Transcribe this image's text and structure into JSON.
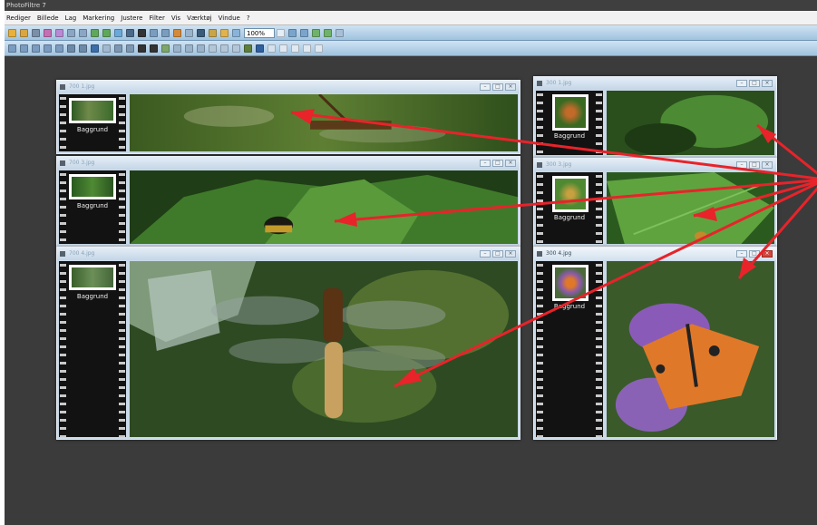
{
  "app": {
    "title": "PhotoFiltre 7",
    "menu": [
      "Rediger",
      "Billede",
      "Lag",
      "Markering",
      "Justere",
      "Filter",
      "Vis",
      "Værktøj",
      "Vindue",
      "?"
    ],
    "zoom_value": "100%"
  },
  "colors": {
    "workspace_bg": "#3b3b3b",
    "toolbar_top": "#cfe3f3",
    "window_frame": "#c9d9e8",
    "arrow": "#e8232a"
  },
  "windows": [
    {
      "title": "700 1.jpg",
      "layer_label": "Baggrund"
    },
    {
      "title": "300 1.jpg",
      "layer_label": "Baggrund"
    },
    {
      "title": "700 3.jpg",
      "layer_label": "Baggrund"
    },
    {
      "title": "300 3.jpg",
      "layer_label": "Baggrund"
    },
    {
      "title": "700 4.jpg",
      "layer_label": "Baggrund"
    },
    {
      "title": "300 4.jpg",
      "layer_label": "Baggrund"
    }
  ]
}
